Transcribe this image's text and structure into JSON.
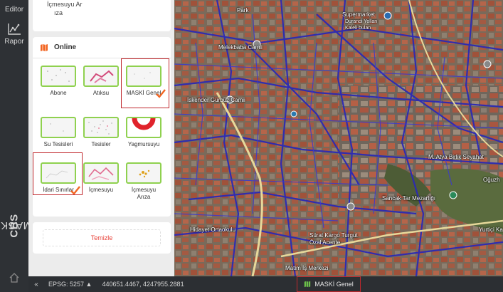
{
  "rail": {
    "editor_label": "Editor",
    "report_label": "Rapor",
    "brand_light": "MASKİ",
    "brand_bold": "CBS"
  },
  "top_card": {
    "partial_lines": [
      "İçmesuyu Ar",
      "ıza"
    ]
  },
  "online": {
    "title": "Online",
    "accent": "#f26522",
    "layers": [
      {
        "label": "Abone",
        "checked": false,
        "highlighted": false
      },
      {
        "label": "Atıksu",
        "checked": false,
        "highlighted": false
      },
      {
        "label": "MASKİ Genel",
        "checked": true,
        "highlighted": true
      },
      {
        "label": "Su Tesisleri",
        "checked": false,
        "highlighted": false
      },
      {
        "label": "Tesisler",
        "checked": false,
        "highlighted": false
      },
      {
        "label": "Yagmursuyu",
        "checked": false,
        "highlighted": false
      },
      {
        "label": "İdari Sınırlar",
        "checked": true,
        "highlighted": true
      },
      {
        "label": "İçmesuyu",
        "checked": false,
        "highlighted": false
      },
      {
        "label": "İçmesuyu Arıza",
        "checked": false,
        "highlighted": false
      }
    ]
  },
  "clear_label": "Temizle",
  "map_labels": [
    {
      "text": "Park"
    },
    {
      "text": "Supermarket"
    },
    {
      "text": "Durandi Yollan"
    },
    {
      "text": "Kaleli bulan"
    },
    {
      "text": "Melekbaba Camii"
    },
    {
      "text": "İskender Gürbüz Camii"
    },
    {
      "text": "M. Atya Birlik Seyahat"
    },
    {
      "text": "Oğuzh"
    },
    {
      "text": "Sancak Tar Mezarlığı"
    },
    {
      "text": "Hidayet Ortaokulu"
    },
    {
      "text": "Sürat Kargo Turgut Özal Acente"
    },
    {
      "text": "Matim İş Merkezi"
    },
    {
      "text": "Yurtiçi Ka"
    }
  ],
  "status": {
    "collapse_glyph": "«",
    "epsg": "EPSG: 5257 ▲",
    "coordinates": "440651.4467,  4247955.2881",
    "active_layer": "MASKİ Genel"
  }
}
